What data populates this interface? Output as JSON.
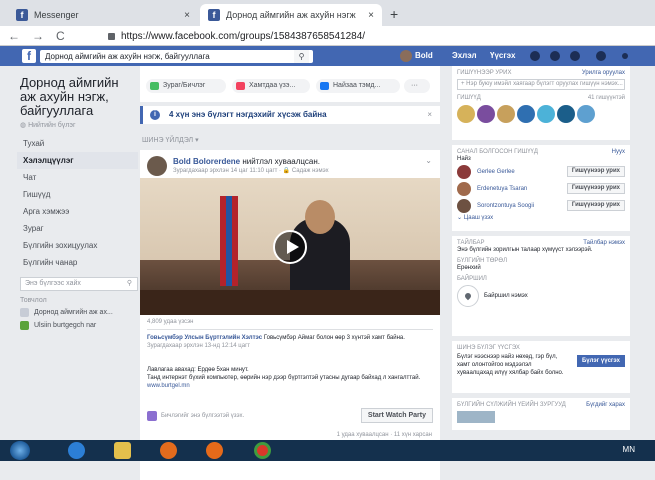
{
  "browser": {
    "tabs": [
      {
        "title": "Messenger"
      },
      {
        "title": "Дорнод аймгийн аж ахуйн нэгж"
      }
    ],
    "new_tab": "+",
    "close": "×",
    "url": "https://www.facebook.com/groups/1584387658541284/"
  },
  "fb_header": {
    "search_value": "Дорнод аймгийн аж ахуйн нэгж, байгууллага",
    "user": "Bold",
    "home": "Эхлэл",
    "create": "Үүсгэх"
  },
  "left": {
    "group_name": "Дорнод аймгийн аж ахуйн нэгж, байгууллага",
    "group_type": "Нийтийн бүлэг",
    "menu": [
      "Тухай",
      "Хэлэлцүүлэг",
      "Чат",
      "Гишүүд",
      "Арга хэмжээ",
      "Зураг",
      "Бүлгийн зохицуулах",
      "Бүлгийн чанар"
    ],
    "search_placeholder": "Энэ бүлгээс хайх",
    "shortcuts_title": "Товчлол",
    "shortcuts": [
      "Дорнод аймгийн аж ах...",
      "Ulsiin burtgegch nar"
    ]
  },
  "composer": {
    "chips": [
      "Зураг/Бичлэг",
      "Хамтдаа үзэ...",
      "Найзаа тэмд..."
    ],
    "more": "···"
  },
  "notice": {
    "text": "4 хүн энэ бүлэгт нэгдэхийг хүсэж байна",
    "info": "i"
  },
  "recent_label": "ШИНЭ ҮЙЛДЭЛ ▾",
  "post": {
    "author": "Bold Bolorerdene",
    "action": " нийтлэл хуваалцсан.",
    "meta": "Зурагдахаар эрхлэн 14 цаг 11:10 цагт · 🔒 Садаж нэмэх",
    "views": "4,809 удаа үзсэн",
    "shared_org": "Говьсүмбэр Улсын Бүртгэлийн Хэлтэс",
    "shared_rest": " Говьсүмбэр Аймаг болон өөр 3 хүнтэй хамт байна.",
    "shared_meta": "Зурагдахаар эрхлэн 13-нд 12:14 цагт",
    "body_line1": "Лавлагаа авахад: Ердөө 5хан минут.",
    "body_line2": "Танд интернэт бүхий компьютер, өөрийн нэр дээр бүртгэлтэй утасны дугаар байхад л хангалттай.",
    "body_link": "www.burtgel.mn",
    "watch_note": "Бичлэгийг энэ бүлгээтэй үзэх.",
    "watch_button": "Start Watch Party",
    "stats": "1 удаа хуваалцсан · 11 хүн харсан"
  },
  "right": {
    "invite_title": "ГИШҮҮНЭЭР УРИХ",
    "invite_link": "Урилга оруулах",
    "invite_placeholder": "+ Нэр буюу имэйл хаягаар бүлэгт оруулах гишүүн нэмэх...",
    "members_title": "ГИШҮҮД",
    "members_count": "41 гишүүнтэй",
    "suggested_title": "САНАЛ БОЛГОСОН ГИШҮҮД",
    "suggested_link": "Нуух",
    "suggested_sub": "Найз",
    "suggested": [
      "Gerlee Gerlee",
      "Erdenetuya Tsaran",
      "Sorontzontuya Soogii"
    ],
    "invite_button": "Гишүүнээр урих",
    "see_all": "Цааш үзэх",
    "desc_title": "ТАЙЛБАР",
    "desc_link": "Тайлбар нэмэх",
    "desc_text": "Энэ бүлгийн зорилгын талаар хүмүүст хэлээрэй.",
    "type_title": "БҮЛГИЙН ТӨРӨЛ",
    "type_value": "Ерөнхий",
    "location_title": "БАЙРШИЛ",
    "location_text": "Байршил нэмэх",
    "create_title": "ШИНЭ БҮЛЭГ ҮҮСГЭХ",
    "create_text": "Бүлэг нээснээр найз нөхөд, гэр бүл, хамт олонтойгоо мэдээлэл хуваалцахад илүү хялбар байх болно.",
    "create_button": "Бүлэг үүсгэх",
    "suggested_groups_title": "БҮЛГИЙН СҮЛЖИЙН ҮЕИЙН ЗУРГУУД",
    "suggested_groups_link": "Бүгдийг харах"
  },
  "taskbar": {
    "lang": "MN"
  }
}
